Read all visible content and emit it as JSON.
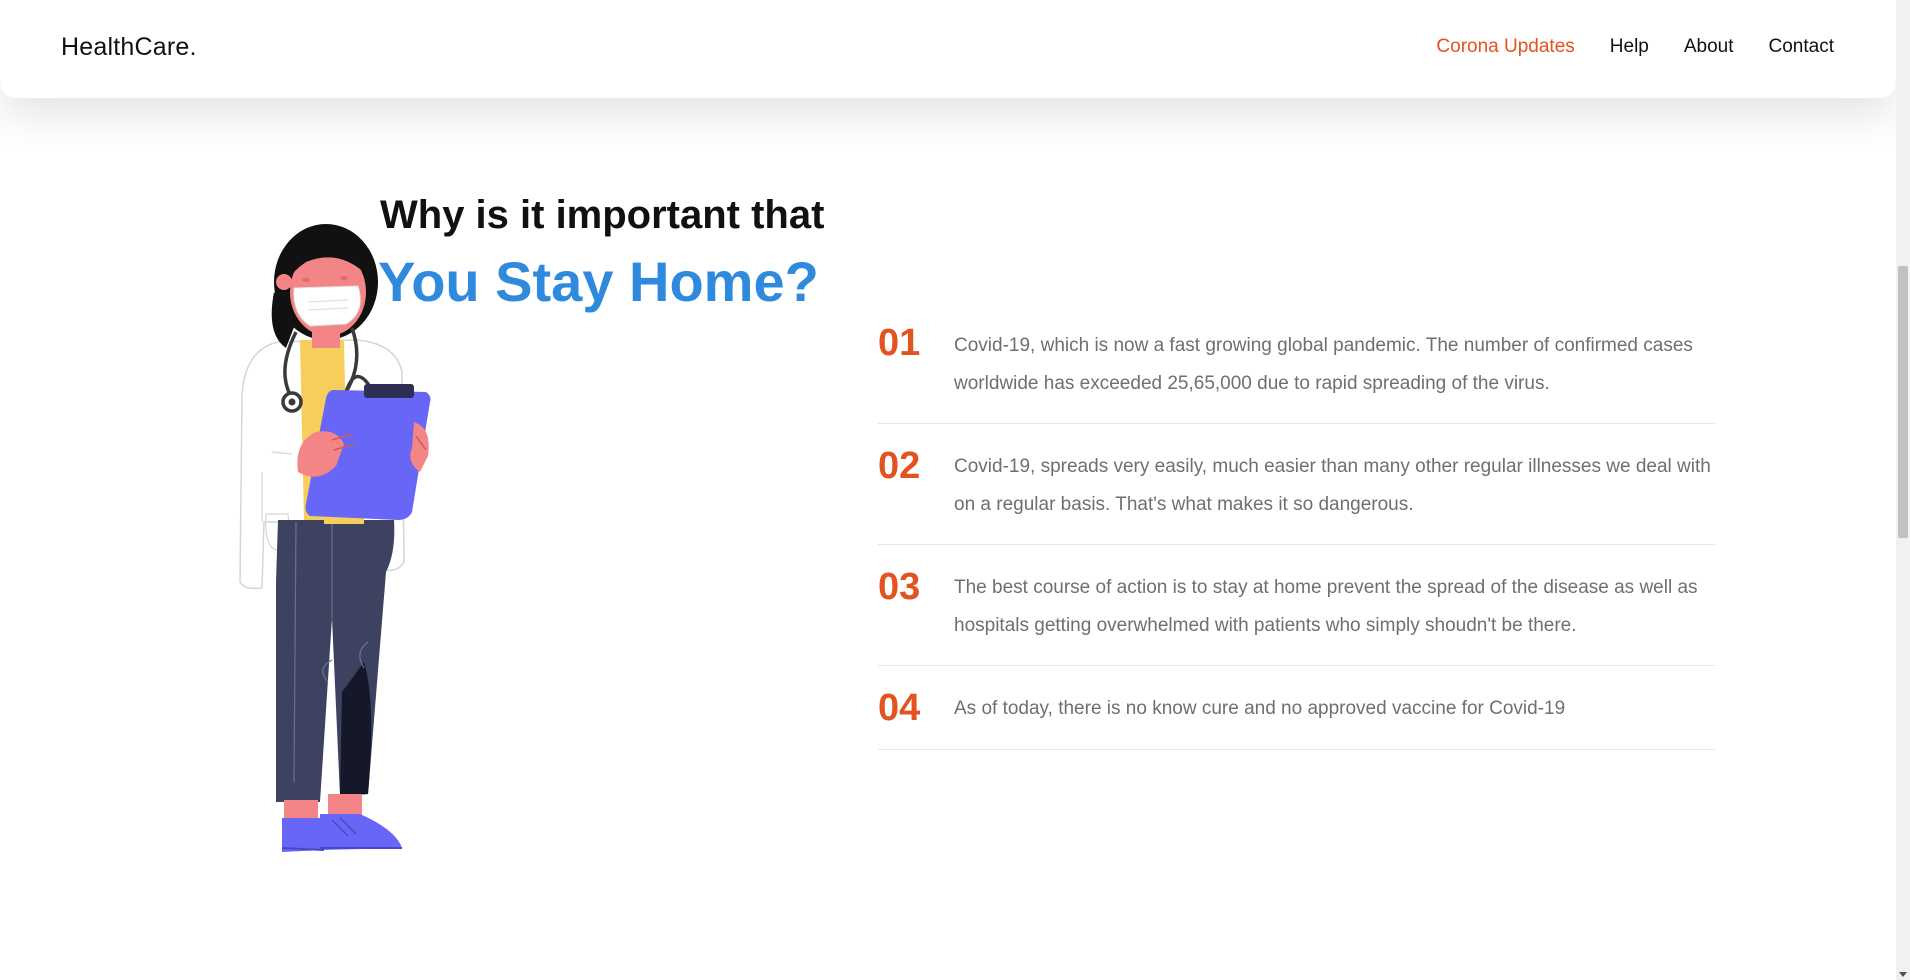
{
  "header": {
    "brand": "HealthCare.",
    "nav": [
      {
        "label": "Corona Updates",
        "active": true
      },
      {
        "label": "Help",
        "active": false
      },
      {
        "label": "About",
        "active": false
      },
      {
        "label": "Contact",
        "active": false
      }
    ]
  },
  "hero": {
    "heading_line1": "Why is it important that",
    "heading_line2": "You Stay Home?"
  },
  "reasons": [
    {
      "number": "01",
      "text": "Covid-19, which is now a fast growing global pandemic. The number of confirmed cases worldwide has exceeded 25,65,000 due to rapid spreading of the virus."
    },
    {
      "number": "02",
      "text": "Covid-19, spreads very easily, much easier than many other regular illnesses we deal with on a regular basis. That's what makes it so dangerous."
    },
    {
      "number": "03",
      "text": "The best course of action is to stay at home prevent the spread of the disease as well as hospitals getting overwhelmed with patients who simply shoudn't be there."
    },
    {
      "number": "04",
      "text": "As of today, there is no know cure and no approved vaccine for Covid-19"
    }
  ],
  "colors": {
    "accent": "#e2531f",
    "heading_blue": "#2f8ade",
    "body_text": "#6f6f6f",
    "clipboard": "#6766f7",
    "pants": "#3c4260",
    "skin": "#f48587"
  },
  "icons": {
    "illustration": "doctor-with-clipboard-illustration"
  }
}
